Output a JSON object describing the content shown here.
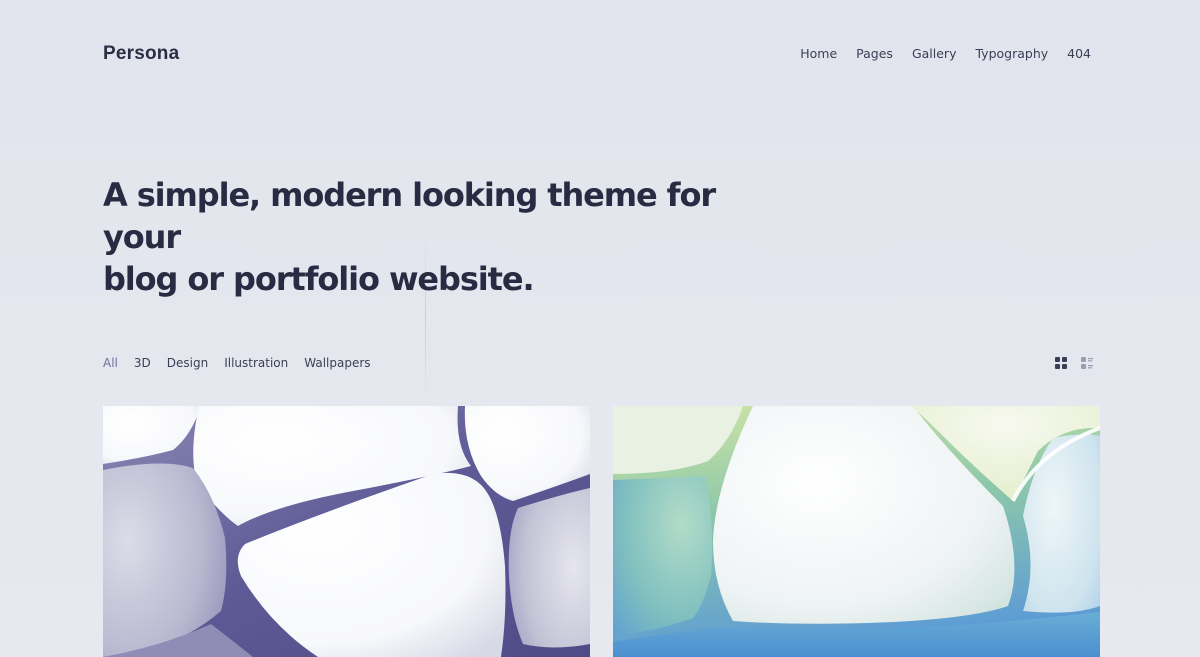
{
  "site": {
    "logo": "Persona"
  },
  "nav": {
    "items": [
      {
        "label": "Home"
      },
      {
        "label": "Pages"
      },
      {
        "label": "Gallery"
      },
      {
        "label": "Typography"
      },
      {
        "label": "404"
      }
    ]
  },
  "hero": {
    "line1": "A simple, modern looking theme for your",
    "line2": "blog or portfolio website."
  },
  "filters": {
    "active": "All",
    "items": [
      {
        "label": "All"
      },
      {
        "label": "3D"
      },
      {
        "label": "Design"
      },
      {
        "label": "Illustration"
      },
      {
        "label": "Wallpapers"
      }
    ]
  },
  "view_toggle": {
    "grid_icon": "grid-view-icon",
    "list_icon": "list-view-icon"
  },
  "gallery": {
    "cards": [
      {
        "image": "white-cells-on-purple-3d-abstract",
        "accent": "#5b5893"
      },
      {
        "image": "white-cells-on-green-blue-gradient-3d-abstract",
        "accent": "#5b9ad6"
      }
    ]
  },
  "colors": {
    "background": "#e4e6ee",
    "text": "#2a2f45",
    "active_filter": "#6f6fa0"
  }
}
